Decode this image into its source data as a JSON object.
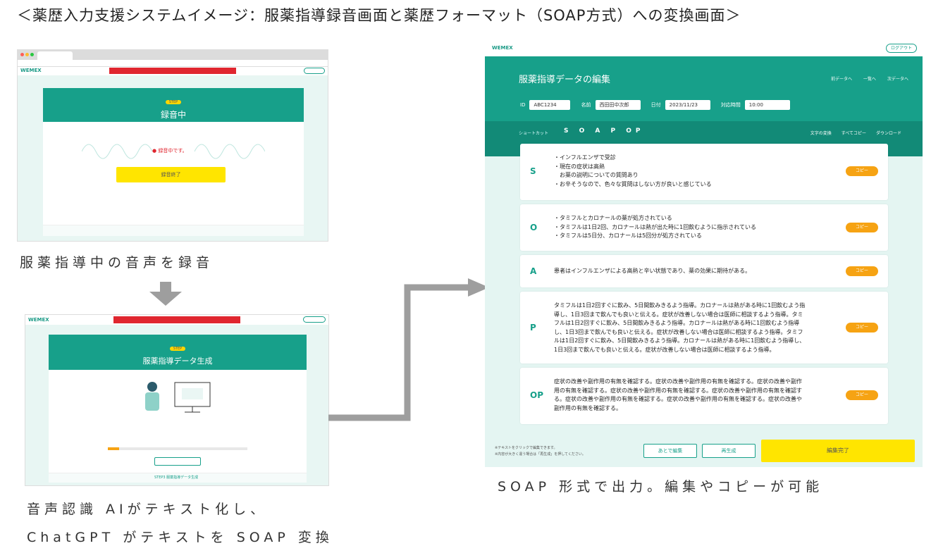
{
  "heading": "＜薬歴入力支援システムイメージ：服薬指導録音画面と薬歴フォーマット（SOAP方式）への変換画面＞",
  "captions": {
    "record": "服薬指導中の音声を録音",
    "convert_line1": "音声認識 AIがテキスト化し、",
    "convert_line2": "ChatGPT がテキストを SOAP 変換",
    "output": "SOAP 形式で出力。編集やコピーが可能"
  },
  "screen1": {
    "brand": "WEMEX",
    "step": "STEP",
    "title": "録音中",
    "status": "録音中です。",
    "button": "録音終了"
  },
  "screen2": {
    "brand": "WEMEX",
    "step": "STEP",
    "title": "服薬指導データ生成",
    "stepnav": "STEP3 服薬指導データ生成"
  },
  "editor": {
    "brand": "WEMEX",
    "logout": "ログアウト",
    "title": "服薬指導データの編集",
    "nav": [
      "前データへ",
      "一覧へ",
      "次データへ"
    ],
    "fields": [
      {
        "label": "ID",
        "value": "ABC1234"
      },
      {
        "label": "名前",
        "value": "西田田中次郎"
      },
      {
        "label": "日付",
        "value": "2023/11/23"
      },
      {
        "label": "対応時間",
        "value": "10:00"
      }
    ],
    "shortcut": "ショートカット",
    "tabs": [
      "S",
      "O",
      "A",
      "P",
      "OP"
    ],
    "actions": [
      "文字の変換",
      "すべてコピー",
      "ダウンロード"
    ],
    "copy_label": "コピー",
    "rows": [
      {
        "letter": "S",
        "lines": [
          "・インフルエンザで受診",
          "・現在の症状は高熱",
          "　お薬の説明についての質問あり",
          "・お辛そうなので、色々な質問はしない方が良いと感じている"
        ]
      },
      {
        "letter": "O",
        "lines": [
          "・タミフルとカロナールの薬が処方されている",
          "・タミフルは1日2回、カロナールは熱が出た時に1回飲むように指示されている",
          "・タミフルは5日分、カロナールは5回分が処方されている"
        ]
      },
      {
        "letter": "A",
        "lines": [
          "患者はインフルエンザによる高熱と辛い状態であり、薬の効果に期待がある。"
        ]
      },
      {
        "letter": "P",
        "lines": [
          "タミフルは1日2回すぐに飲み、5日間飲みきるよう指導。カロナールは熱がある時に1回飲むよう指",
          "導し、1日3回まで飲んでも良いと伝える。症状が改善しない場合は医師に相談するよう指導。タミ",
          "フルは1日2回すぐに飲み、5日間飲みきるよう指導。カロナールは熱がある時に1回飲むよう指導",
          "し、1日3回まで飲んでも良いと伝える。症状が改善しない場合は医師に相談するよう指導。タミフ",
          "ルは1日2回すぐに飲み、5日間飲みきるよう指導。カロナールは熱がある時に1回飲むよう指導し、",
          "1日3回まで飲んでも良いと伝える。症状が改善しない場合は医師に相談するよう指導。"
        ]
      },
      {
        "letter": "OP",
        "lines": [
          "症状の改善や副作用の有無を確認する。症状の改善や副作用の有無を確認する。症状の改善や副作",
          "用の有無を確認する。症状の改善や副作用の有無を確認する。症状の改善や副作用の有無を確認す",
          "る。症状の改善や副作用の有無を確認する。症状の改善や副作用の有無を確認する。症状の改善や",
          "副作用の有無を確認する。"
        ]
      }
    ],
    "footer_note1": "※テキストをクリックで編集できます。",
    "footer_note2": "※内容が大きく違う場合は「再生成」を押してください。",
    "later": "あとで編集",
    "regen": "再生成",
    "done": "編集完了"
  },
  "colors": {
    "teal": "#17a08a",
    "yellow": "#ffe500",
    "orange": "#f6a313",
    "red": "#e0262f"
  }
}
